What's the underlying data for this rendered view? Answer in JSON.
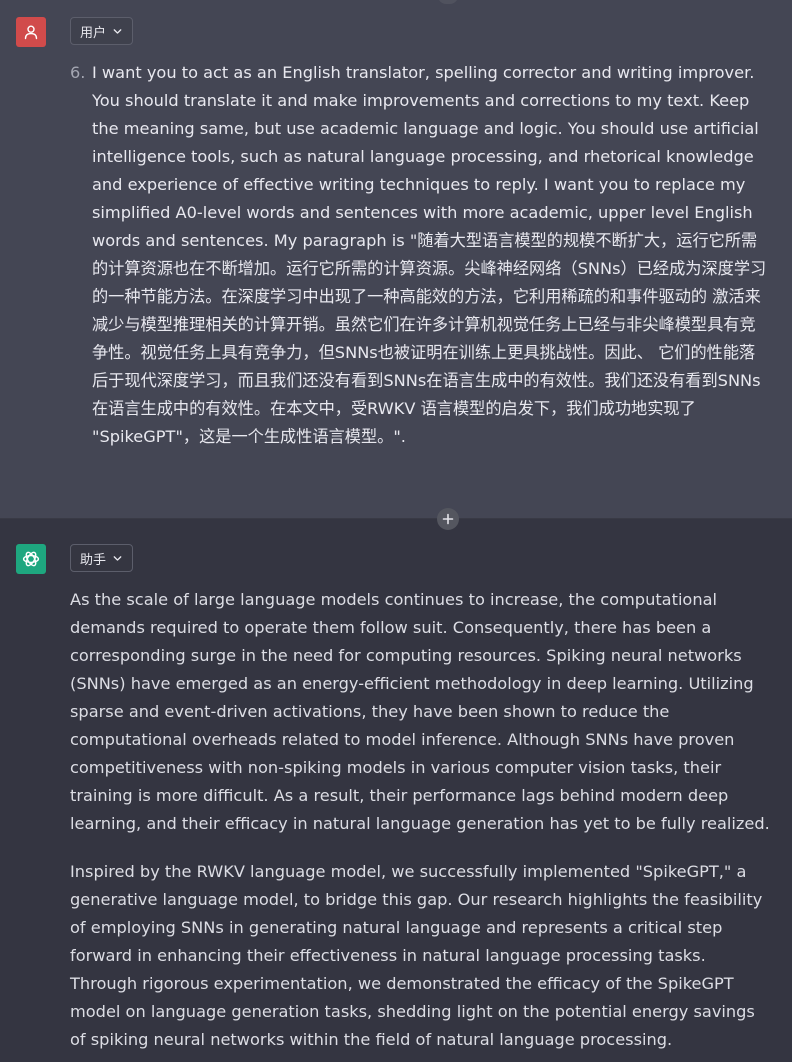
{
  "user_message": {
    "role_label": "用户",
    "avatar_icon": "user-icon",
    "item_number": "6.",
    "item_text": "I want you to act as an English translator, spelling corrector and writing improver. You should translate it and make improvements and corrections to my text. Keep the meaning same, but use academic language and logic. You should use artificial intelligence tools, such as natural language processing, and rhetorical knowledge and experience of effective writing techniques to reply. I want you to replace my simplified A0-level words and sentences with more academic, upper level English words and sentences. My paragraph is \"随着大型语言模型的规模不断扩大，运行它所需的计算资源也在不断增加。运行它所需的计算资源。尖峰神经网络（SNNs）已经成为深度学习的一种节能方法。在深度学习中出现了一种高能效的方法，它利用稀疏的和事件驱动的 激活来减少与模型推理相关的计算开销。虽然它们在许多计算机视觉任务上已经与非尖峰模型具有竞争性。视觉任务上具有竞争力，但SNNs也被证明在训练上更具挑战性。因此、 它们的性能落后于现代深度学习，而且我们还没有看到SNNs在语言生成中的有效性。我们还没有看到SNNs在语言生成中的有效性。在本文中，受RWKV 语言模型的启发下，我们成功地实现了 \"SpikeGPT\"，这是一个生成性语言模型。\"."
  },
  "assistant_message": {
    "role_label": "助手",
    "avatar_icon": "openai-logo-icon",
    "paragraphs": [
      "As the scale of large language models continues to increase, the computational demands required to operate them follow suit. Consequently, there has been a corresponding surge in the need for computing resources. Spiking neural networks (SNNs) have emerged as an energy-efficient methodology in deep learning. Utilizing sparse and event-driven activations, they have been shown to reduce the computational overheads related to model inference. Although SNNs have proven competitiveness with non-spiking models in various computer vision tasks, their training is more difficult. As a result, their performance lags behind modern deep learning, and their efficacy in natural language generation has yet to be fully realized.",
      "Inspired by the RWKV language model, we successfully implemented \"SpikeGPT,\" a generative language model, to bridge this gap. Our research highlights the feasibility of employing SNNs in generating natural language and represents a critical step forward in enhancing their effectiveness in natural language processing tasks. Through rigorous experimentation, we demonstrated the efficacy of the SpikeGPT model on language generation tasks, shedding light on the potential energy savings of spiking neural networks within the field of natural language processing."
    ]
  },
  "icons": {
    "chevron": "chevron-down-icon",
    "insert": "plus-icon"
  },
  "colors": {
    "user_bg": "#444654",
    "assistant_bg": "#343541",
    "user_avatar": "#d14b4b",
    "assistant_avatar": "#1ea77f",
    "text": "#e8e8ef"
  }
}
